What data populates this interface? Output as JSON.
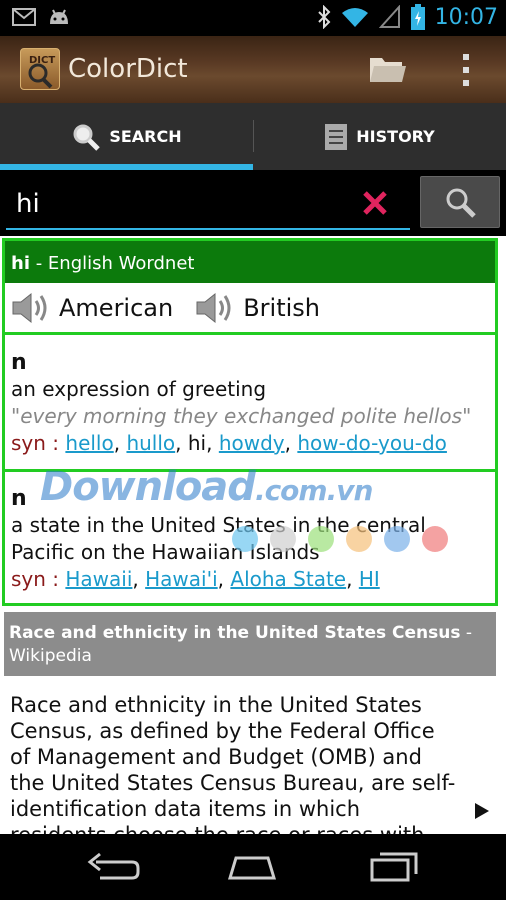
{
  "status_bar": {
    "time": "10:07"
  },
  "app": {
    "title": "ColorDict"
  },
  "tabs": [
    {
      "label": "SEARCH",
      "selected": true
    },
    {
      "label": "HISTORY",
      "selected": false
    }
  ],
  "search": {
    "value": "hi"
  },
  "entry": {
    "word": "hi",
    "source": " - English Wordnet",
    "audio": {
      "american": "American",
      "british": "British"
    },
    "senses": [
      {
        "pos": "n",
        "definition": "an expression of greeting",
        "example": "\"every morning they exchanged polite hellos\"",
        "syn_label": "syn",
        "synonyms": [
          "hello",
          "hullo",
          "hi",
          "howdy",
          "how-do-you-do"
        ]
      },
      {
        "pos": "n",
        "definition": "a state in the United States in the central Pacific on the Hawaiian Islands",
        "syn_label": "syn",
        "synonyms": [
          "Hawaii",
          "Hawai'i",
          "Aloha State",
          "HI"
        ]
      }
    ]
  },
  "watermark": {
    "main": "Download",
    "suffix": ".com.vn"
  },
  "wiki": {
    "title": "Race and ethnicity in the United States Census",
    "source": "Wikipedia",
    "body": "Race and ethnicity in the United States Census, as defined by the Federal Office of Management and Budget (OMB) and the United States Census Bureau, are self-identification data items in which residents choose the race or races with which they"
  },
  "colors": {
    "accent": "#33b5e5",
    "green": "#22cc22",
    "green_dark": "#0c7a0c",
    "link": "#1a9acb"
  }
}
